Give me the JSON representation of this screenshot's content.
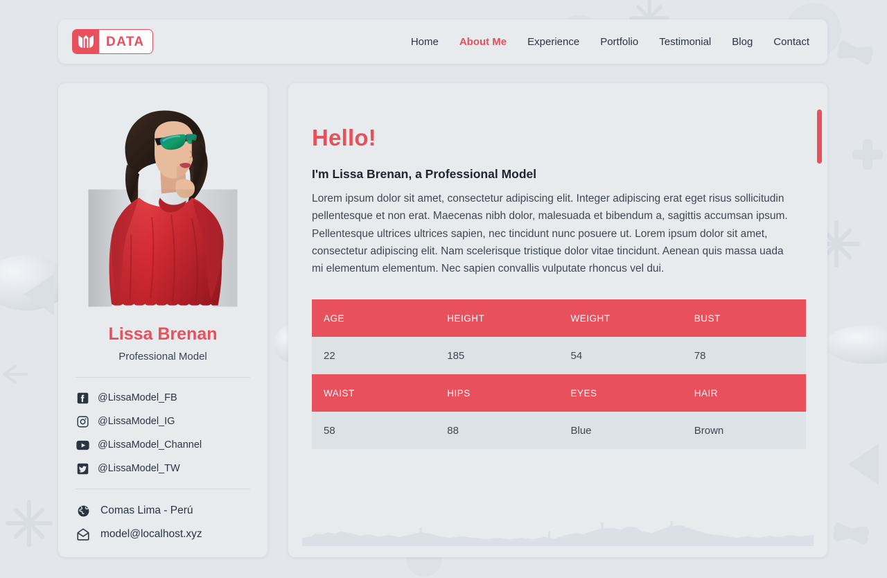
{
  "brand": {
    "mark_icon": "m-monogram-icon",
    "text": "DATA",
    "color": "#e8505b"
  },
  "nav": {
    "items": [
      {
        "label": "Home",
        "active": false
      },
      {
        "label": "About Me",
        "active": true
      },
      {
        "label": "Experience",
        "active": false
      },
      {
        "label": "Portfolio",
        "active": false
      },
      {
        "label": "Testimonial",
        "active": false
      },
      {
        "label": "Blog",
        "active": false
      },
      {
        "label": "Contact",
        "active": false
      }
    ]
  },
  "profile": {
    "photo_alt": "model-portrait-red-jacket",
    "name": "Lissa Brenan",
    "role": "Professional Model",
    "social": [
      {
        "icon": "facebook-icon",
        "handle": "@LissaModel_FB"
      },
      {
        "icon": "instagram-icon",
        "handle": "@LissaModel_IG"
      },
      {
        "icon": "youtube-icon",
        "handle": "@LissaModel_Channel"
      },
      {
        "icon": "twitter-icon",
        "handle": "@LissaModel_TW"
      }
    ],
    "contact": [
      {
        "icon": "globe-icon",
        "text": "Comas Lima - Perú"
      },
      {
        "icon": "envelope-icon",
        "text": "model@localhost.xyz"
      }
    ]
  },
  "main": {
    "greeting": "Hello!",
    "subtitle": "I'm Lissa Brenan, a Professional Model",
    "paragraph": "Lorem ipsum dolor sit amet, consectetur adipiscing elit. Integer adipiscing erat eget risus sollicitudin pellentesque et non erat. Maecenas nibh dolor, malesuada et bibendum a, sagittis accumsan ipsum. Pellentesque ultrices ultrices sapien, nec tincidunt nunc posuere ut. Lorem ipsum dolor sit amet, consectetur adipiscing elit. Nam scelerisque tristique dolor vitae tincidunt. Aenean quis massa uada mi elementum elementum. Nec sapien convallis vulputate rhoncus vel dui.",
    "spec_table": {
      "block1": {
        "headers": [
          "AGE",
          "HEIGHT",
          "WEIGHT",
          "BUST"
        ],
        "values": [
          "22",
          "185",
          "54",
          "78"
        ]
      },
      "block2": {
        "headers": [
          "WAIST",
          "HIPS",
          "EYES",
          "HAIR"
        ],
        "values": [
          "58",
          "88",
          "Blue",
          "Brown"
        ]
      }
    },
    "scrollbar": {
      "thumb_color": "#e8505b"
    }
  },
  "theme": {
    "accent": "#e8505b",
    "panel_bg": "#e8ebee",
    "page_bg": "#e3e7eb",
    "row_bg": "#dde2e7",
    "text": "#2b3440"
  }
}
